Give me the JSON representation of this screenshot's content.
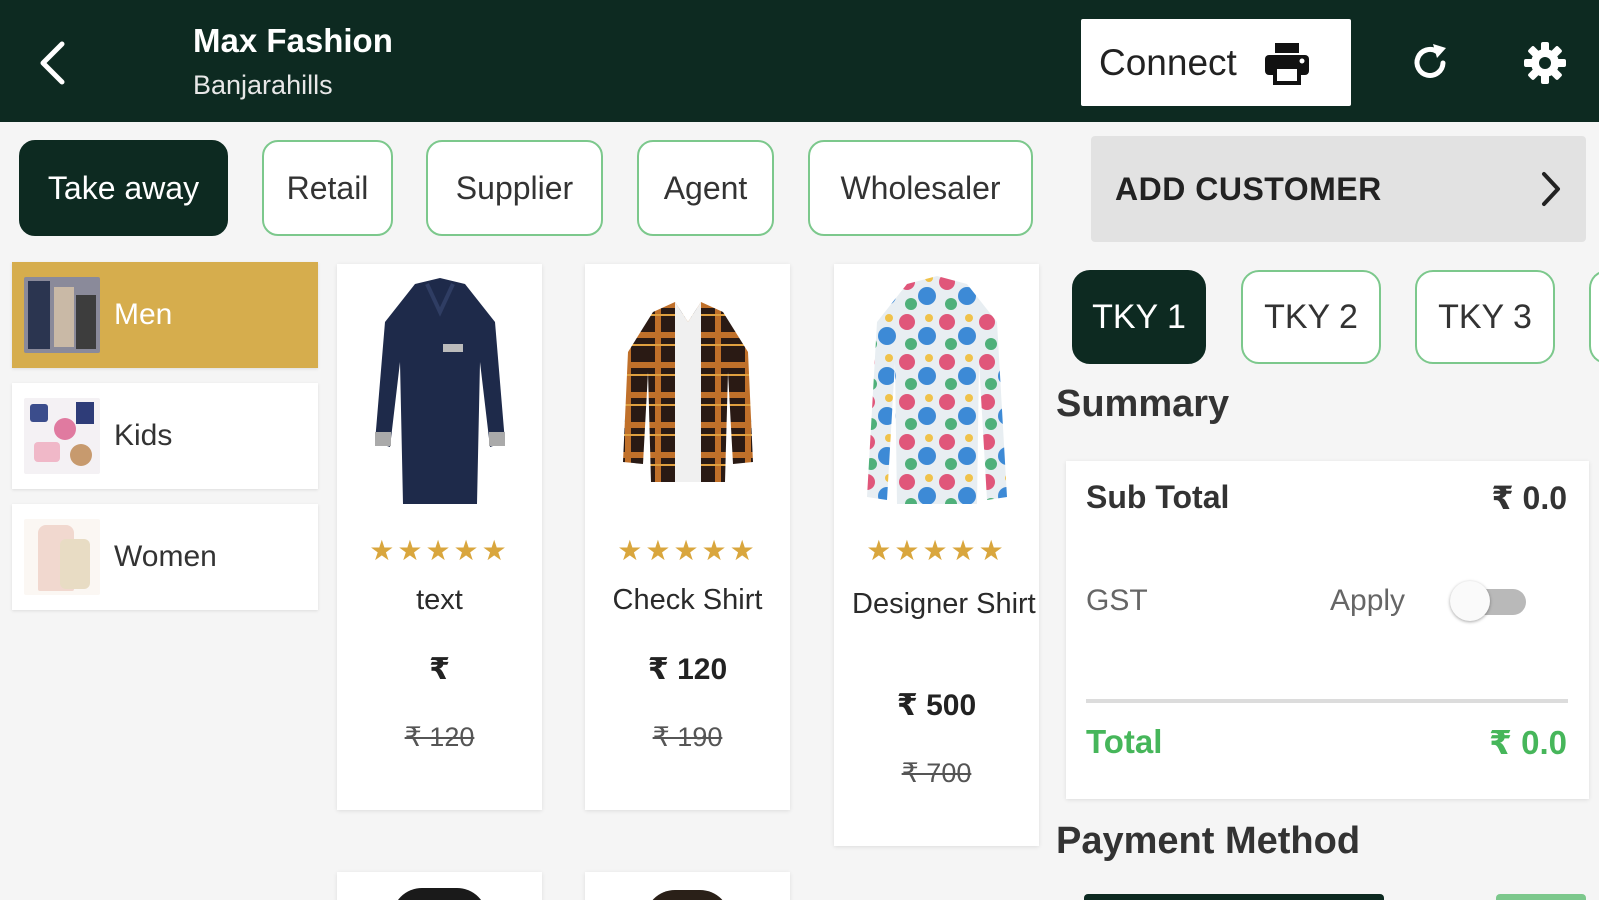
{
  "header": {
    "store_name": "Max Fashion",
    "location": "Banjarahills",
    "connect_label": "Connect",
    "bg_color": "#0d2a21"
  },
  "customer_types": [
    "Take away",
    "Retail",
    "Supplier",
    "Agent",
    "Wholesaler"
  ],
  "add_customer_label": "ADD CUSTOMER",
  "categories": [
    {
      "label": "Men",
      "active": true
    },
    {
      "label": "Kids",
      "active": false
    },
    {
      "label": "Women",
      "active": false
    }
  ],
  "products": [
    {
      "name": "text",
      "stars": "★★★★★",
      "price": "₹",
      "mrp": "₹ 120"
    },
    {
      "name": "Check Shirt",
      "stars": "★★★★★",
      "price": "₹ 120",
      "mrp": "₹ 190"
    },
    {
      "name": "Designer Shirt",
      "stars": "★★★★★",
      "price": "₹ 500",
      "mrp": "₹ 700"
    }
  ],
  "tickets": [
    "TKY 1",
    "TKY 2",
    "TKY 3"
  ],
  "summary": {
    "title": "Summary",
    "subtotal_label": "Sub Total",
    "subtotal_value": "₹ 0.0",
    "gst_label": "GST",
    "apply_label": "Apply",
    "gst_applied": false,
    "total_label": "Total",
    "total_value": "₹ 0.0"
  },
  "payment_title": "Payment Method",
  "colors": {
    "accent_green": "#46b65a",
    "category_active": "#d6ad4d",
    "star": "#d9a63d"
  }
}
